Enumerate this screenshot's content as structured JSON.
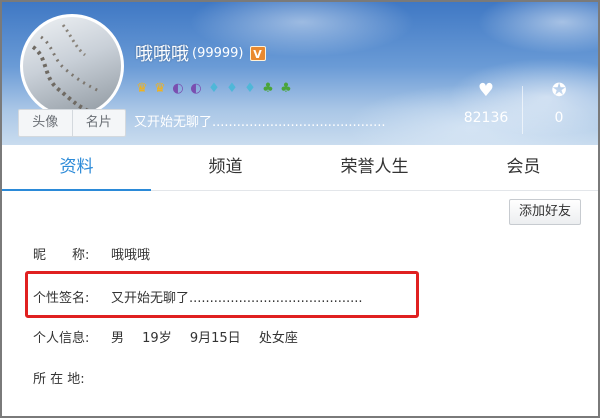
{
  "header": {
    "avatar_tabs": [
      "头像",
      "名片"
    ],
    "nickname": "哦哦哦",
    "qq_level": "(99999)",
    "vip_label": "V",
    "badges": [
      {
        "icon": "crown-icon",
        "glyph": "♛"
      },
      {
        "icon": "crown-icon",
        "glyph": "♛"
      },
      {
        "icon": "moon-icon",
        "glyph": "◐"
      },
      {
        "icon": "moon-icon",
        "glyph": "◐"
      },
      {
        "icon": "star-icon",
        "glyph": "♦"
      },
      {
        "icon": "star-icon",
        "glyph": "♦"
      },
      {
        "icon": "star-icon",
        "glyph": "♦"
      },
      {
        "icon": "sun-icon",
        "glyph": "♣"
      },
      {
        "icon": "sun-icon",
        "glyph": "♣"
      }
    ],
    "signature": "又开始无聊了..........................................",
    "likes": "82136",
    "honors": "0"
  },
  "tabs": [
    "资料",
    "频道",
    "荣誉人生",
    "会员"
  ],
  "actions": {
    "add_friend": "添加好友"
  },
  "profile": {
    "nick_label": "昵　　称:",
    "nick_value": "哦哦哦",
    "sig_label": "个性签名:",
    "sig_value": "又开始无聊了..........................................",
    "personal_label": "个人信息:",
    "gender": "男",
    "age": "19岁",
    "birthday": "9月15日",
    "zodiac": "处女座",
    "location_label": "所 在 地:",
    "location_value": ""
  },
  "colors": {
    "accent": "#2b8ad8",
    "highlight": "#e02020",
    "vip": "#e9892f"
  }
}
